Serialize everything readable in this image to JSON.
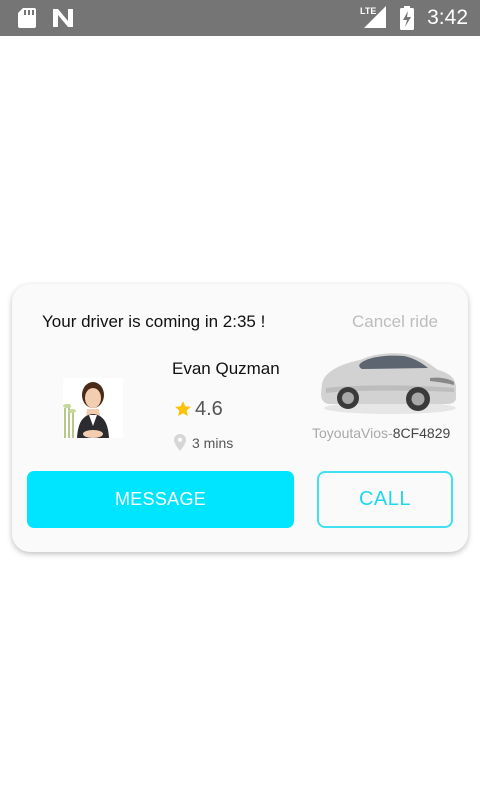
{
  "status_bar": {
    "time": "3:42",
    "network_label": "LTE",
    "icons": [
      "sd-card-icon",
      "n-notification-icon",
      "lte-signal-icon",
      "battery-charging-icon"
    ]
  },
  "ride_card": {
    "title": "Your driver is coming in 2:35 !",
    "cancel_label": "Cancel ride",
    "driver": {
      "name": "Evan Quzman",
      "rating": "4.6",
      "eta": "3 mins"
    },
    "car": {
      "model": "ToyoutaVios",
      "separator": "-",
      "plate": "8CF4829"
    },
    "message_label": "MESSAGE",
    "call_label": "CALL"
  },
  "colors": {
    "accent": "#00e5ff",
    "status_bar": "#757575",
    "star": "#ffc107"
  }
}
